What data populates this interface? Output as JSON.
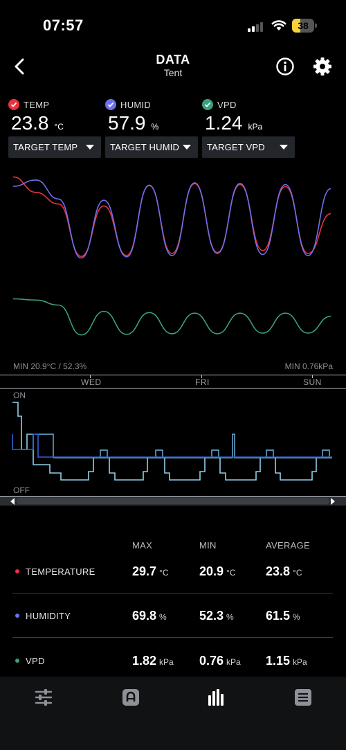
{
  "status_bar": {
    "time": "07:57",
    "battery": "38",
    "battery_level": 0.38
  },
  "header": {
    "title": "DATA",
    "subtitle": "Tent"
  },
  "readings": [
    {
      "label": "TEMP",
      "value": "23.8",
      "unit": "°C",
      "color": "#e8323e"
    },
    {
      "label": "HUMID",
      "value": "57.9",
      "unit": "%",
      "color": "#6f6ff0"
    },
    {
      "label": "VPD",
      "value": "1.24",
      "unit": "kPa",
      "color": "#3aa17a"
    }
  ],
  "target_selects": [
    {
      "label": "TARGET TEMP"
    },
    {
      "label": "TARGET HUMID"
    },
    {
      "label": "TARGET VPD"
    }
  ],
  "chart": {
    "min_left": "MIN 20.9°C / 52.3%",
    "min_right": "MIN 0.76kPa",
    "day_labels": [
      "WED",
      "FRI",
      "SUN"
    ],
    "device_on": "ON",
    "device_off": "OFF"
  },
  "chart_data": {
    "type": "line",
    "x": [
      0,
      0.5,
      1,
      1.5,
      2,
      2.5,
      3,
      3.5,
      4,
      4.5,
      5,
      5.5,
      6,
      6.5,
      7
    ],
    "series": [
      {
        "color": "#e8323e",
        "values": [
          29.4,
          27.8,
          26.6,
          21.2,
          26.4,
          21.3,
          28.5,
          21.5,
          28.7,
          21.6,
          28.6,
          21.8,
          28.4,
          21.5,
          25.6
        ]
      },
      {
        "color": "#6f6ff0",
        "values": [
          55.0,
          53.9,
          57.2,
          67.4,
          57.4,
          67.2,
          54.8,
          67.0,
          54.4,
          66.6,
          54.5,
          66.8,
          54.7,
          67.0,
          55.4
        ]
      },
      {
        "color": "#3aa17a",
        "values": [
          1.5,
          1.48,
          1.4,
          0.92,
          1.3,
          0.93,
          1.28,
          0.94,
          1.27,
          0.94,
          1.27,
          0.95,
          1.27,
          0.95,
          1.22
        ]
      }
    ]
  },
  "stats": {
    "headers": {
      "max": "MAX",
      "min": "MIN",
      "average": "AVERAGE"
    },
    "rows": [
      {
        "name": "TEMPERATURE",
        "color": "#e8323e",
        "max": "29.7",
        "min": "20.9",
        "average": "23.8",
        "unit": "°C"
      },
      {
        "name": "HUMIDITY",
        "color": "#6f6ff0",
        "max": "69.8",
        "min": "52.3",
        "average": "61.5",
        "unit": "%"
      },
      {
        "name": "VPD",
        "color": "#3aa17a",
        "max": "1.82",
        "min": "0.76",
        "average": "1.15",
        "unit": "kPa"
      }
    ]
  },
  "bottom_nav": [
    "sliders-icon",
    "controller-icon",
    "bar-chart-icon",
    "list-icon"
  ]
}
